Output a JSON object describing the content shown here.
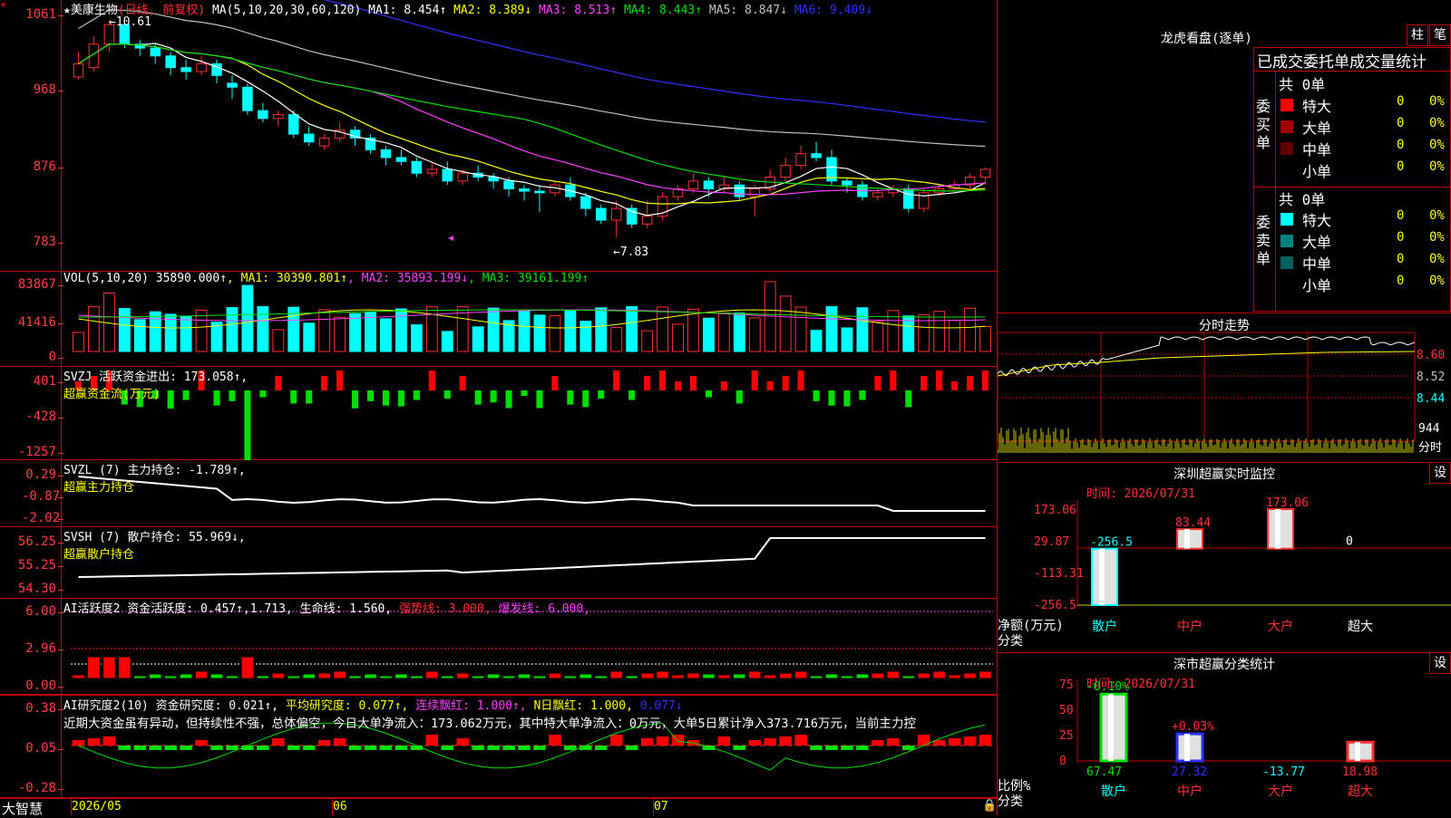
{
  "kline": {
    "title": "★美康生物",
    "mode": "(日线, 前复权)",
    "ma_label": "MA(5,10,20,30,60,120)",
    "ma": [
      {
        "name": "MA1:",
        "value": "8.454↑",
        "color": "#ffffff"
      },
      {
        "name": "MA2:",
        "value": "8.389↓",
        "color": "#ffff00"
      },
      {
        "name": "MA3:",
        "value": "8.513↑",
        "color": "#ff40ff"
      },
      {
        "name": "MA4:",
        "value": "8.443↑",
        "color": "#00e000"
      },
      {
        "name": "MA5:",
        "value": "8.847↓",
        "color": "#c0c0c0"
      },
      {
        "name": "MA6:",
        "value": "9.409↓",
        "color": "#3030ff"
      }
    ],
    "yticks": [
      "1061",
      "968",
      "876",
      "783"
    ],
    "high_mark": "←10.61",
    "low_mark": "←7.83",
    "candles": [
      [
        9.88,
        10.05,
        10.2,
        9.85
      ],
      [
        10.0,
        10.3,
        10.4,
        9.95
      ],
      [
        10.3,
        10.55,
        10.61,
        10.2
      ],
      [
        10.55,
        10.3,
        10.6,
        10.25
      ],
      [
        10.3,
        10.25,
        10.35,
        10.15
      ],
      [
        10.25,
        10.15,
        10.3,
        10.05
      ],
      [
        10.15,
        10.0,
        10.2,
        9.9
      ],
      [
        10.0,
        9.95,
        10.1,
        9.85
      ],
      [
        9.95,
        10.05,
        10.15,
        9.9
      ],
      [
        10.05,
        9.9,
        10.1,
        9.8
      ],
      [
        9.8,
        9.75,
        9.9,
        9.6
      ],
      [
        9.75,
        9.45,
        9.8,
        9.4
      ],
      [
        9.45,
        9.35,
        9.55,
        9.3
      ],
      [
        9.35,
        9.4,
        9.45,
        9.25
      ],
      [
        9.4,
        9.15,
        9.45,
        9.1
      ],
      [
        9.15,
        9.05,
        9.25,
        9.0
      ],
      [
        9.0,
        9.1,
        9.15,
        8.95
      ],
      [
        9.1,
        9.2,
        9.3,
        9.05
      ],
      [
        9.2,
        9.1,
        9.25,
        9.0
      ],
      [
        9.1,
        8.95,
        9.15,
        8.9
      ],
      [
        8.95,
        8.85,
        9.0,
        8.75
      ],
      [
        8.85,
        8.8,
        8.95,
        8.75
      ],
      [
        8.8,
        8.65,
        8.85,
        8.6
      ],
      [
        8.65,
        8.7,
        8.8,
        8.6
      ],
      [
        8.7,
        8.55,
        8.8,
        8.5
      ],
      [
        8.55,
        8.65,
        8.7,
        8.5
      ],
      [
        8.65,
        8.6,
        8.75,
        8.55
      ],
      [
        8.6,
        8.55,
        8.65,
        8.45
      ],
      [
        8.55,
        8.45,
        8.6,
        8.35
      ],
      [
        8.45,
        8.42,
        8.5,
        8.3
      ],
      [
        8.42,
        8.4,
        8.5,
        8.15
      ],
      [
        8.4,
        8.5,
        8.55,
        8.35
      ],
      [
        8.5,
        8.35,
        8.6,
        8.3
      ],
      [
        8.35,
        8.2,
        8.4,
        8.1
      ],
      [
        8.2,
        8.05,
        8.25,
        8.0
      ],
      [
        8.05,
        8.2,
        8.3,
        7.83
      ],
      [
        8.2,
        8.0,
        8.25,
        7.95
      ],
      [
        8.0,
        8.1,
        8.3,
        7.95
      ],
      [
        8.1,
        8.35,
        8.4,
        8.05
      ],
      [
        8.35,
        8.45,
        8.5,
        8.3
      ],
      [
        8.45,
        8.55,
        8.65,
        8.4
      ],
      [
        8.55,
        8.45,
        8.6,
        8.35
      ],
      [
        8.45,
        8.5,
        8.6,
        8.4
      ],
      [
        8.5,
        8.35,
        8.55,
        8.3
      ],
      [
        8.35,
        8.45,
        8.5,
        8.1
      ],
      [
        8.45,
        8.6,
        8.7,
        8.4
      ],
      [
        8.6,
        8.75,
        8.85,
        8.55
      ],
      [
        8.75,
        8.9,
        9.0,
        8.7
      ],
      [
        8.9,
        8.85,
        9.05,
        8.8
      ],
      [
        8.85,
        8.55,
        8.95,
        8.5
      ],
      [
        8.55,
        8.5,
        8.6,
        8.4
      ],
      [
        8.5,
        8.35,
        8.55,
        8.3
      ],
      [
        8.35,
        8.4,
        8.45,
        8.3
      ],
      [
        8.4,
        8.45,
        8.5,
        8.35
      ],
      [
        8.45,
        8.2,
        8.5,
        8.15
      ],
      [
        8.2,
        8.4,
        8.45,
        8.15
      ],
      [
        8.4,
        8.45,
        8.5,
        8.35
      ],
      [
        8.45,
        8.5,
        8.55,
        8.4
      ],
      [
        8.5,
        8.6,
        8.65,
        8.45
      ],
      [
        8.6,
        8.7,
        8.72,
        8.5
      ]
    ]
  },
  "vol": {
    "label": "VOL(5,10,20)",
    "value": "35890.000↑",
    "ma": [
      {
        "name": "MA1:",
        "value": "30390.801↑",
        "color": "#ffff00"
      },
      {
        "name": "MA2:",
        "value": "35893.199↓",
        "color": "#ff40ff"
      },
      {
        "name": "MA3:",
        "value": "39161.199↑",
        "color": "#00e000"
      }
    ],
    "yticks": [
      "83867",
      "41416",
      "0"
    ]
  },
  "svzj": {
    "label": "SVZJ  活跃资金进出:",
    "value": "173.058↑,",
    "sub": "超赢资金流(万元)",
    "yticks": [
      "401",
      "-428",
      "-1257"
    ]
  },
  "svzl": {
    "label": "SVZL (7) 主力持仓:",
    "value": "-1.789↑,",
    "sub": "超赢主力持仓",
    "yticks": [
      "0.29",
      "-0.87",
      "-2.02"
    ]
  },
  "svsh": {
    "label": "SVSH (7) 散户持仓:",
    "value": "55.969↓,",
    "sub": "超赢散户持仓",
    "yticks": [
      "56.25",
      "55.25",
      "54.30"
    ]
  },
  "ai1": {
    "label": "AI活跃度2 资金活跃度:",
    "v1": "0.457↑",
    "v2": ",1.713,",
    "v3": "生命线: 1.560,",
    "v4": "强势线: 3.000,",
    "v5": "爆发线: 6.000,",
    "yticks": [
      "6.00",
      "2.96",
      "0.00"
    ]
  },
  "ai2": {
    "label": "AI研究度2(10) 资金研究度:",
    "v1": "0.021↑",
    "v2": "平均研究度: 0.077↑,",
    "v3": "连续飘红: 1.000↑,",
    "v4": "N日飘红: 1.000,",
    "v5": "0.077↓",
    "note": "近期大资金虽有异动，但持续性不强，总体偏空，今日大单净流入：173.062万元，其中特大单净流入：0万元，大单5日累计净入373.716万元，当前主力控",
    "yticks": [
      "0.38",
      "0.05",
      "-0.28"
    ]
  },
  "xaxis": {
    "brand": "大智慧",
    "dates": [
      "2026/05",
      "06",
      "07"
    ]
  },
  "lhb": {
    "title": "龙虎看盘(逐单)",
    "tab1": "柱",
    "tab2": "笔",
    "subtitle": "已成交委托单成交量统计",
    "buy": {
      "side": "委买单",
      "total": "共 0单",
      "rows": [
        {
          "name": "特大",
          "v": "0",
          "p": "0%",
          "color": "#ff0000"
        },
        {
          "name": "大单",
          "v": "0",
          "p": "0%",
          "color": "#a00000"
        },
        {
          "name": "中单",
          "v": "0",
          "p": "0%",
          "color": "#600000"
        },
        {
          "name": "小单",
          "v": "0",
          "p": "0%",
          "color": "#000000"
        }
      ]
    },
    "sell": {
      "side": "委卖单",
      "total": "共 0单",
      "rows": [
        {
          "name": "特大",
          "v": "0",
          "p": "0%",
          "color": "#00ffff"
        },
        {
          "name": "大单",
          "v": "0",
          "p": "0%",
          "color": "#008080"
        },
        {
          "name": "中单",
          "v": "0",
          "p": "0%",
          "color": "#006060"
        },
        {
          "name": "小单",
          "v": "0",
          "p": "0%",
          "color": "#000000"
        }
      ]
    }
  },
  "fenshi": {
    "title": "分时走势",
    "yticks": [
      "8.60",
      "8.52",
      "8.44"
    ],
    "vol_tick": "944",
    "unit": "分时"
  },
  "monitor": {
    "title": "深圳超赢实时监控",
    "set": "设",
    "time": "时间: 2026/07/31",
    "ylabel": "净额(万元)",
    "xlabel": "分类",
    "yticks": [
      "173.06",
      "29.87",
      "-113.31",
      "-256.5"
    ],
    "bars": [
      {
        "cat": "散户",
        "value": -256.5,
        "label": "-256.5"
      },
      {
        "cat": "中户",
        "value": 83.44,
        "label": "83.44"
      },
      {
        "cat": "大户",
        "value": 173.06,
        "label": "173.06"
      },
      {
        "cat": "超大",
        "value": 0,
        "label": "0"
      }
    ]
  },
  "classify": {
    "title": "深市超赢分类统计",
    "set": "设",
    "time": "时间: 2026/07/31",
    "ylabel": "比例%",
    "xlabel": "分类",
    "yticks": [
      "75",
      "50",
      "25",
      "0"
    ],
    "bars": [
      {
        "cat": "散户",
        "value": 67.47,
        "label": "67.47",
        "delta": "-0.10%"
      },
      {
        "cat": "中户",
        "value": 27.32,
        "label": "27.32",
        "delta": "+0.03%"
      },
      {
        "cat": "大户",
        "value": -13.77,
        "label": "-13.77",
        "delta": ""
      },
      {
        "cat": "超大",
        "value": 18.98,
        "label": "18.98",
        "delta": ""
      }
    ]
  },
  "chart_data": {
    "type": "candlestick",
    "title": "美康生物",
    "ylim": [
      7.83,
      10.61
    ],
    "x": [
      "2026/05",
      "06",
      "07"
    ]
  }
}
